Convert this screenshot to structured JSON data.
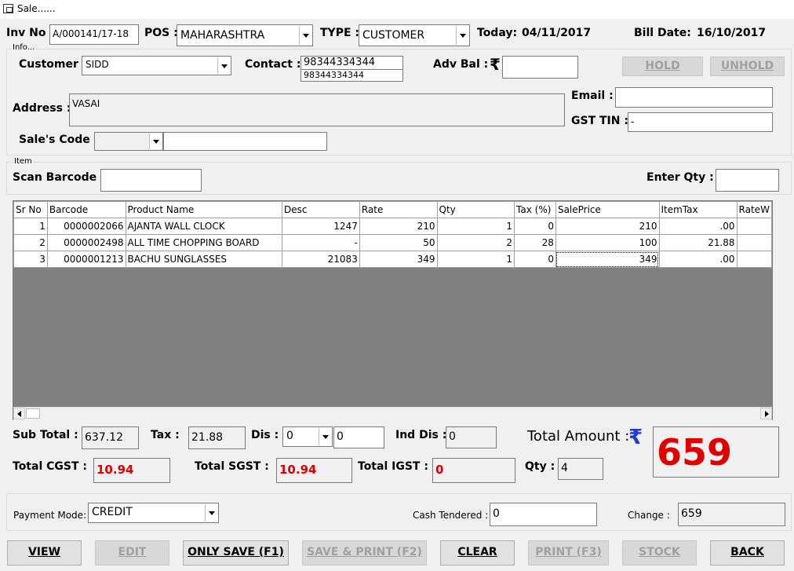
{
  "window": {
    "title": "Sale......"
  },
  "header": {
    "inv_no_label": "Inv No :",
    "inv_no_value": "A/000141/17-18",
    "pos_label": "POS :",
    "pos_value": "MAHARASHTRA",
    "type_label": "TYPE :",
    "type_value": "CUSTOMER",
    "today_label": "Today:",
    "today_value": "04/11/2017",
    "bill_date_label": "Bill Date:",
    "bill_date_value": "16/10/2017"
  },
  "info": {
    "group_title": "Info...",
    "customer_label": "Customer :",
    "customer_value": "SIDD",
    "contact_label": "Contact :",
    "contact_value": "98344334344",
    "contact_suggestion": "98344334344",
    "adv_bal_label": "Adv Bal :",
    "adv_bal_value": "",
    "rupee_symbol": "₹",
    "hold_label": "HOLD",
    "unhold_label": "UNHOLD",
    "address_label": "Address :",
    "address_value": "VASAI",
    "email_label": "Email :",
    "email_value": "",
    "gst_tin_label": "GST TIN :",
    "gst_tin_value": "-",
    "sales_code_label": "Sale's Code :",
    "sales_code_value": "",
    "sales_code_text": ""
  },
  "item": {
    "group_title": "Item",
    "scan_barcode_label": "Scan Barcode :",
    "scan_barcode_value": "",
    "enter_qty_label": "Enter Qty :",
    "enter_qty_value": ""
  },
  "grid": {
    "columns": [
      "Sr No",
      "Barcode",
      "Product Name",
      "Desc",
      "Rate",
      "Qty",
      "Tax (%)",
      "SalePrice",
      "ItemTax",
      "RateW"
    ],
    "rows": [
      [
        "1",
        "0000002066",
        "AJANTA WALL CLOCK",
        "1247",
        "210",
        "1",
        "0",
        "210",
        ".00",
        ""
      ],
      [
        "2",
        "0000002498",
        "ALL TIME CHOPPING BOARD",
        "-",
        "50",
        "2",
        "28",
        "100",
        "21.88",
        ""
      ],
      [
        "3",
        "0000001213",
        "BACHU SUNGLASSES",
        "21083",
        "349",
        "1",
        "0",
        "349",
        ".00",
        ""
      ]
    ]
  },
  "totals": {
    "sub_total_label": "Sub Total :",
    "sub_total_value": "637.12",
    "tax_label": "Tax :",
    "tax_value": "21.88",
    "dis_label": "Dis :",
    "dis_select_value": "0",
    "dis_value": "0",
    "ind_dis_label": "Ind Dis :",
    "ind_dis_value": "0",
    "total_amount_label": "Total Amount :",
    "total_amount_value": "659",
    "total_cgst_label": "Total CGST :",
    "total_cgst_value": "10.94",
    "total_sgst_label": "Total SGST :",
    "total_sgst_value": "10.94",
    "total_igst_label": "Total IGST :",
    "total_igst_value": "0",
    "qty_label": "Qty :",
    "qty_value": "4"
  },
  "payment": {
    "mode_label": "Payment Mode:",
    "mode_value": "CREDIT",
    "cash_tendered_label": "Cash Tendered :",
    "cash_tendered_value": "0",
    "change_label": "Change :",
    "change_value": "659"
  },
  "buttons": {
    "view": "VIEW",
    "edit": "EDIT",
    "only_save": "ONLY SAVE (F1)",
    "save_print": "SAVE & PRINT (F2)",
    "clear": "CLEAR",
    "print": "PRINT (F3)",
    "stock": "STOCK",
    "back": "BACK"
  },
  "colors": {
    "accent_red": "#e00000",
    "rupee_blue": "#1e3cd8",
    "grid_bg": "#808080"
  }
}
